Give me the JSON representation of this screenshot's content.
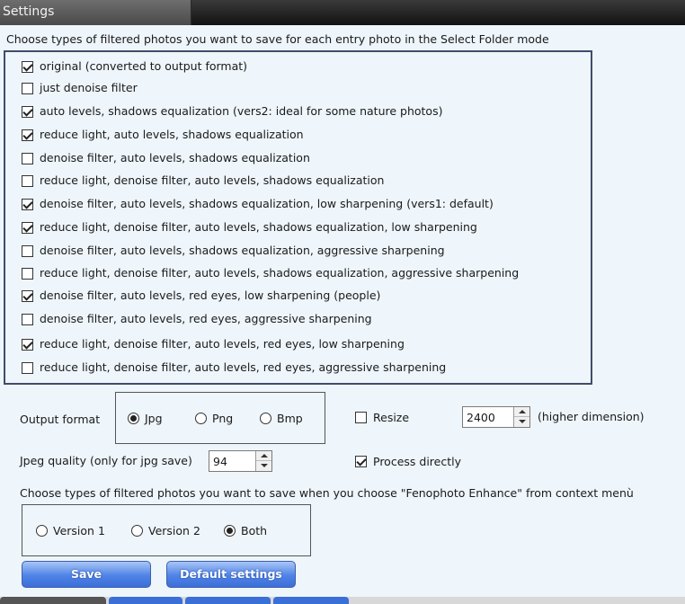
{
  "window": {
    "title": "Settings"
  },
  "intro_text": "Choose types of filtered photos you want to save for each entry photo in the Select Folder mode",
  "filters": [
    {
      "label": "original (converted to output format)",
      "checked": true
    },
    {
      "label": "just denoise filter",
      "checked": false
    },
    {
      "label": "auto levels, shadows equalization (vers2: ideal for some nature photos)",
      "checked": true
    },
    {
      "label": "reduce light, auto levels, shadows equalization",
      "checked": true
    },
    {
      "label": "denoise filter, auto levels, shadows equalization",
      "checked": false
    },
    {
      "label": "reduce light, denoise filter, auto levels, shadows equalization",
      "checked": false
    },
    {
      "label": "denoise filter, auto levels, shadows equalization, low sharpening (vers1: default)",
      "checked": true
    },
    {
      "label": "reduce light, denoise filter, auto levels, shadows equalization, low sharpening",
      "checked": true
    },
    {
      "label": "denoise filter, auto levels, shadows equalization, aggressive sharpening",
      "checked": false
    },
    {
      "label": "reduce light, denoise filter, auto levels, shadows equalization, aggressive sharpening",
      "checked": false
    },
    {
      "label": "denoise filter, auto levels, red eyes, low sharpening (people)",
      "checked": true
    },
    {
      "label": "denoise filter, auto levels, red eyes, aggressive sharpening",
      "checked": false
    },
    {
      "label": "reduce light, denoise filter, auto levels, red eyes, low sharpening",
      "checked": true
    },
    {
      "label": "reduce light, denoise filter, auto levels, red eyes, aggressive sharpening",
      "checked": false
    }
  ],
  "output_format": {
    "label": "Output format",
    "options": [
      "Jpg",
      "Png",
      "Bmp"
    ],
    "selected": "Jpg"
  },
  "resize": {
    "label": "Resize",
    "checked": false,
    "value": "2400",
    "suffix": "(higher dimension)"
  },
  "jpeg_quality": {
    "label": "Jpeg quality (only for jpg save)",
    "value": "94"
  },
  "process_directly": {
    "label": "Process directly",
    "checked": true
  },
  "context_menu": {
    "text": "Choose types of filtered photos you want to save when you choose \"Fenophoto Enhance\" from context menù",
    "options": [
      "Version 1",
      "Version 2",
      "Both"
    ],
    "selected": "Both"
  },
  "buttons": {
    "save": "Save",
    "default": "Default settings"
  },
  "colors": {
    "accent": "#4f83e6",
    "box_border": "#404c6a",
    "background": "#eef5fb"
  }
}
